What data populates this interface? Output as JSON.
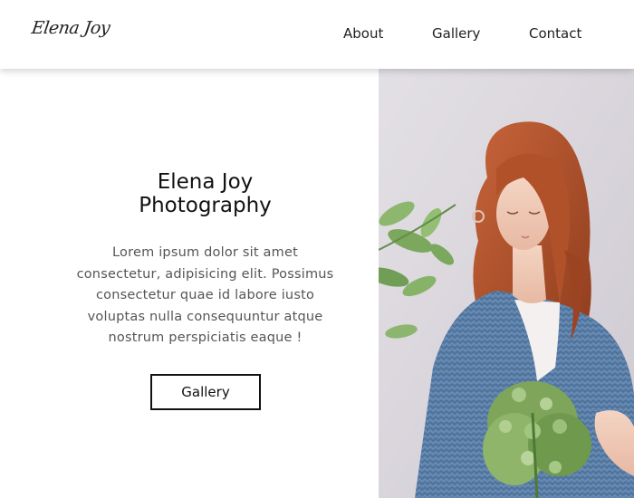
{
  "brand": {
    "logo_text": "Elena Joy"
  },
  "nav": {
    "items": [
      {
        "label": "About"
      },
      {
        "label": "Gallery"
      },
      {
        "label": "Contact"
      }
    ]
  },
  "hero": {
    "title_line1": "Elena Joy",
    "title_line2": "Photography",
    "body_lines": [
      "Lorem ipsum dolor sit amet",
      "consectetur, adipisicing elit. Possimus",
      "consectetur quae id labore iusto",
      "voluptas nulla consequuntur atque",
      "nostrum perspiciatis eaque !"
    ],
    "button_label": "Gallery"
  },
  "colors": {
    "header_bg": "#ffffff",
    "text_dark": "#111111",
    "text_body": "#555555",
    "photo_bg": "#dcd8dd",
    "sweater_blue": "#5a7fa8",
    "hair_red": "#b5542b",
    "leaf_green": "#6fa048"
  }
}
